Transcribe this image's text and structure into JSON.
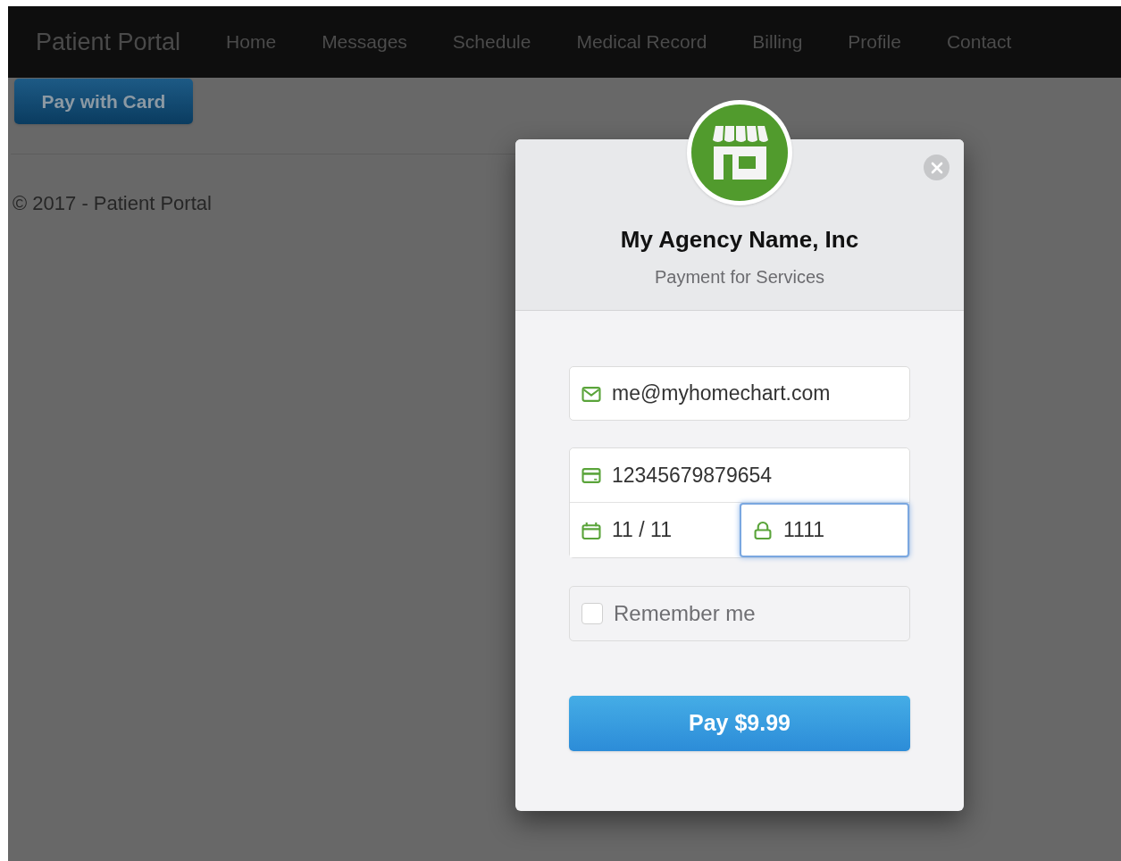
{
  "navbar": {
    "brand": "Patient Portal",
    "items": [
      {
        "label": "Home",
        "selected": false
      },
      {
        "label": "Messages",
        "selected": false
      },
      {
        "label": "Schedule",
        "selected": false
      },
      {
        "label": "Medical Record",
        "selected": false
      },
      {
        "label": "Billing",
        "selected": false
      },
      {
        "label": "Profile",
        "selected": false
      },
      {
        "label": "Contact",
        "selected": false
      }
    ]
  },
  "pay_button": "Pay with Card",
  "footer": "© 2017 - Patient Portal",
  "dialog": {
    "title": "My Agency Name, Inc",
    "subtitle": "Payment for Services",
    "fields": [
      {
        "kind": "email",
        "value": "me@myhomechart.com",
        "focused": false
      },
      {
        "kind": "card",
        "value": "12345679879654",
        "focused": false
      },
      {
        "kind": "expiry",
        "value": "11 / 11",
        "focused": false
      },
      {
        "kind": "cvc",
        "value": "1111",
        "focused": true
      }
    ],
    "remember": {
      "label": "Remember me",
      "checked": false
    },
    "submit": "Pay $9.99"
  }
}
